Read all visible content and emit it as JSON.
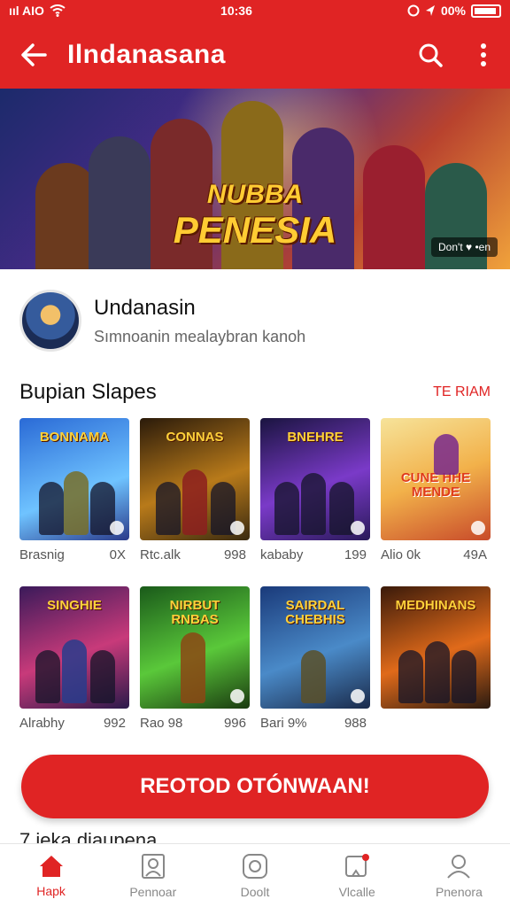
{
  "status_bar": {
    "left_text": "ııl AIO",
    "time": "10:36",
    "battery": "00%"
  },
  "app_bar": {
    "title": "Ilndanasana"
  },
  "banner": {
    "title_line1": "NUBBA",
    "title_line2": "PENESIA",
    "badge": "Don't ♥ •en"
  },
  "profile": {
    "name": "Undanasin",
    "subtitle": "Sımnoanin mealaybran kanoh"
  },
  "section": {
    "title": "Bupian Slapes",
    "link": "TE RIAM"
  },
  "games": [
    {
      "title": "BONNAMA",
      "name": "Brasnig",
      "count": "0X"
    },
    {
      "title": "CONNAS",
      "name": "Rtc.alk",
      "count": "998"
    },
    {
      "title": "BNEHRE",
      "name": "kababy",
      "count": "199"
    },
    {
      "title": "CUNE HHE MENDE",
      "name": "Alio 0k",
      "count": "49A"
    },
    {
      "title": "SINGHIE",
      "name": "Alrabhy",
      "count": "992"
    },
    {
      "title": "NIRBUT RNBAS",
      "name": "Rao 98",
      "count": "996"
    },
    {
      "title": "SAIRDAL CHEBHIS",
      "name": "Bari 9%",
      "count": "988"
    },
    {
      "title": "MEDHINANS",
      "name": "",
      "count": ""
    }
  ],
  "cta": {
    "label": "REOTOD OTÓNWAAN!"
  },
  "peek_text": "7 ieka diaupena",
  "nav": [
    {
      "label": "Hapk",
      "icon": "home-icon"
    },
    {
      "label": "Pennoar",
      "icon": "profile-icon"
    },
    {
      "label": "Doolt",
      "icon": "camera-icon"
    },
    {
      "label": "Vlcalle",
      "icon": "notification-icon"
    },
    {
      "label": "Pnenora",
      "icon": "user-icon"
    }
  ],
  "colors": {
    "accent": "#e02424",
    "background": "#ffffff"
  }
}
